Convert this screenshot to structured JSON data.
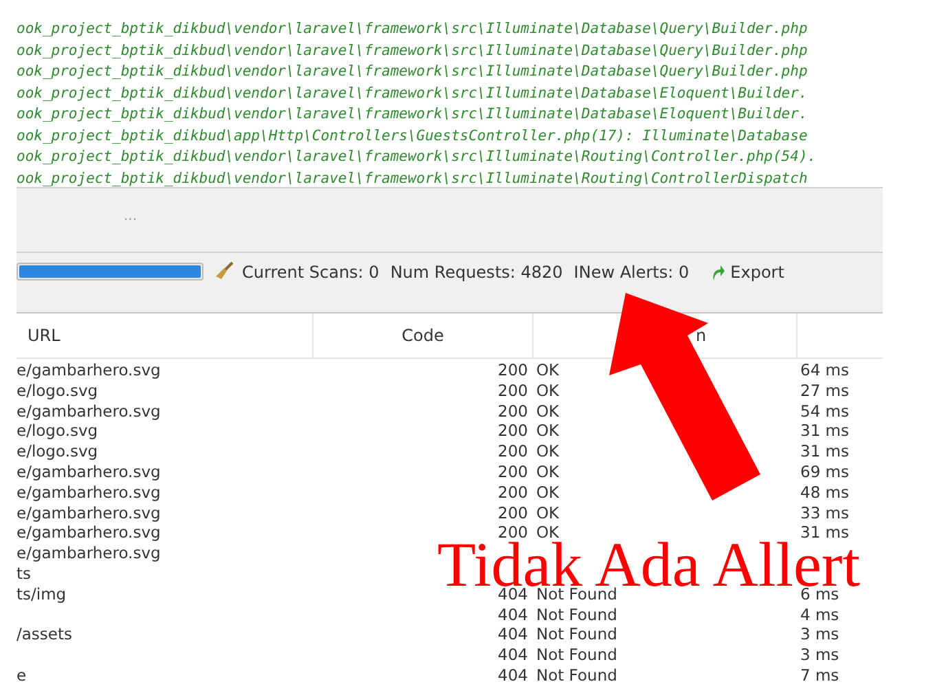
{
  "log_lines": [
    "ook_project_bptik_dikbud\\vendor\\laravel\\framework\\src\\Illuminate\\Database\\Query\\Builder.php",
    "ook_project_bptik_dikbud\\vendor\\laravel\\framework\\src\\Illuminate\\Database\\Query\\Builder.php",
    "ook_project_bptik_dikbud\\vendor\\laravel\\framework\\src\\Illuminate\\Database\\Query\\Builder.php",
    "ook_project_bptik_dikbud\\vendor\\laravel\\framework\\src\\Illuminate\\Database\\Eloquent\\Builder.",
    "ook_project_bptik_dikbud\\vendor\\laravel\\framework\\src\\Illuminate\\Database\\Eloquent\\Builder.",
    "ook_project_bptik_dikbud\\app\\Http\\Controllers\\GuestsController.php(17): Illuminate\\Database",
    "ook_project_bptik_dikbud\\vendor\\laravel\\framework\\src\\Illuminate\\Routing\\Controller.php(54).",
    "ook_project_bptik_dikbud\\vendor\\laravel\\framework\\src\\Illuminate\\Routing\\ControllerDispatch"
  ],
  "toolbar": {
    "more": "..."
  },
  "status": {
    "progress": {
      "level": 1
    },
    "current_scans": "Current Scans: 0",
    "num_requests": "Num Requests: 4820",
    "new_alerts": "INew Alerts: 0",
    "export": "Export"
  },
  "table": {
    "columns": [
      "URL",
      "Code",
      "n"
    ],
    "rows": [
      {
        "url": "e/gambarhero.svg",
        "code": "200",
        "reason": "OK",
        "time": "64 ms"
      },
      {
        "url": "e/logo.svg",
        "code": "200",
        "reason": "OK",
        "time": "27 ms"
      },
      {
        "url": "e/gambarhero.svg",
        "code": "200",
        "reason": "OK",
        "time": "54 ms"
      },
      {
        "url": "e/logo.svg",
        "code": "200",
        "reason": "OK",
        "time": "31 ms"
      },
      {
        "url": "e/logo.svg",
        "code": "200",
        "reason": "OK",
        "time": "31 ms"
      },
      {
        "url": "e/gambarhero.svg",
        "code": "200",
        "reason": "OK",
        "time": "69 ms"
      },
      {
        "url": "e/gambarhero.svg",
        "code": "200",
        "reason": "OK",
        "time": "48 ms"
      },
      {
        "url": "e/gambarhero.svg",
        "code": "200",
        "reason": "OK",
        "time": "33 ms"
      },
      {
        "url": "e/gambarhero.svg",
        "code": "200",
        "reason": "OK",
        "time": "31 ms"
      },
      {
        "url": "e/gambarhero.svg"
      },
      {
        "url": "ts"
      },
      {
        "url": "ts/img",
        "code": "404",
        "reason": "Not Found",
        "time": "6 ms"
      },
      {
        "code": "404",
        "reason": "Not Found",
        "time": "4 ms"
      },
      {
        "url": "/assets",
        "code": "404",
        "reason": "Not Found",
        "time": "3 ms"
      },
      {
        "code": "404",
        "reason": "Not Found",
        "time": "3 ms"
      },
      {
        "url": "e",
        "code": "404",
        "reason": "Not Found",
        "time": "7 ms"
      }
    ]
  },
  "annotation": {
    "text": "Tidak Ada Allert"
  }
}
